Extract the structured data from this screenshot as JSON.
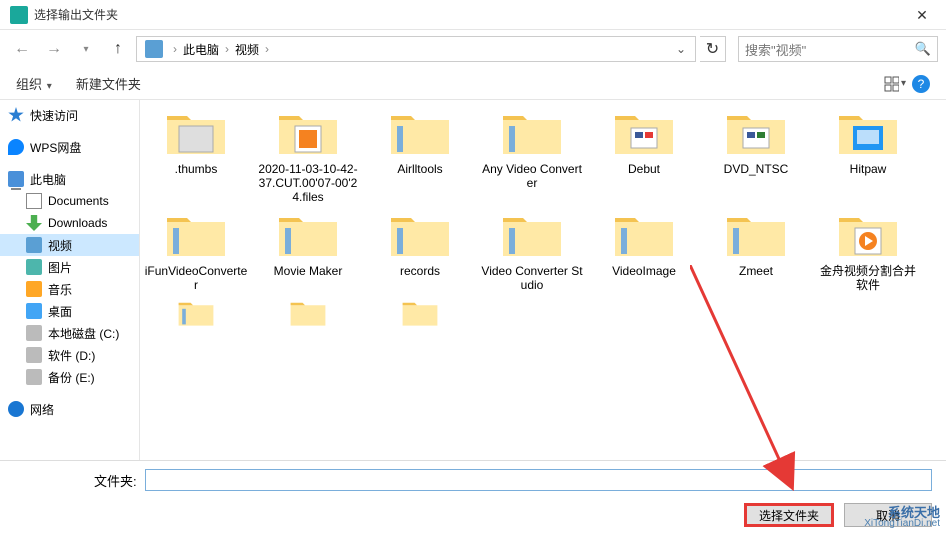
{
  "window": {
    "title": "选择输出文件夹"
  },
  "breadcrumb": {
    "parts": [
      "此电脑",
      "视频"
    ],
    "refresh": "↻"
  },
  "search": {
    "placeholder": "搜索\"视频\""
  },
  "toolbar": {
    "organize": "组织",
    "new_folder": "新建文件夹"
  },
  "sidebar": {
    "quick": "快速访问",
    "wps": "WPS网盘",
    "pc": "此电脑",
    "documents": "Documents",
    "downloads": "Downloads",
    "video": "视频",
    "pictures": "图片",
    "music": "音乐",
    "desktop": "桌面",
    "disk_c": "本地磁盘 (C:)",
    "disk_d": "软件 (D:)",
    "disk_e": "备份 (E:)",
    "network": "网络"
  },
  "files": {
    "row1": [
      {
        "name": ".thumbs"
      },
      {
        "name": "2020-11-03-10-42-37.CUT.00'07-00'24.files"
      },
      {
        "name": "Airlltools"
      },
      {
        "name": "Any Video Converter"
      },
      {
        "name": "Debut"
      },
      {
        "name": "DVD_NTSC"
      },
      {
        "name": "Hitpaw"
      }
    ],
    "row2": [
      {
        "name": "iFunVideoConverter"
      },
      {
        "name": "Movie Maker"
      },
      {
        "name": "records"
      },
      {
        "name": "Video Converter Studio"
      },
      {
        "name": "VideoImage"
      },
      {
        "name": "Zmeet"
      },
      {
        "name": "金舟视频分割合并软件"
      }
    ],
    "row3": [
      {
        "name": ""
      },
      {
        "name": ""
      },
      {
        "name": ""
      }
    ]
  },
  "footer": {
    "folder_label": "文件夹:",
    "folder_value": "",
    "select_btn": "选择文件夹",
    "cancel_btn": "取消"
  },
  "watermark": {
    "line1": "系统天地",
    "line2": "XiTongTianDi.net"
  }
}
